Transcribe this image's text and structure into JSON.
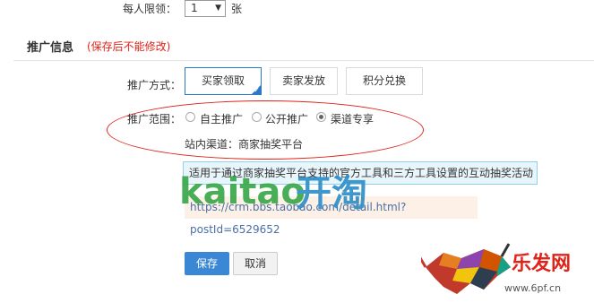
{
  "limit": {
    "label": "每人限领：",
    "value": "1",
    "unit": "张"
  },
  "section": {
    "title": "推广信息",
    "note": "(保存后不能修改)"
  },
  "method": {
    "label": "推广方式：",
    "options": [
      {
        "label": "买家领取",
        "selected": true
      },
      {
        "label": "卖家发放",
        "selected": false
      },
      {
        "label": "积分兑换",
        "selected": false
      }
    ]
  },
  "scope": {
    "label": "推广范围：",
    "options": [
      {
        "label": "自主推广",
        "checked": false
      },
      {
        "label": "公开推广",
        "checked": false
      },
      {
        "label": "渠道专享",
        "checked": true
      }
    ],
    "station_label": "站内渠道：",
    "station_value": "商家抽奖平台"
  },
  "info": {
    "description": "适用于通过商家抽奖平台支持的官方工具和三方工具设置的互动抽奖活动",
    "url": "https://crm.bbs.taobao.com/detail.html?postId=6529652"
  },
  "actions": {
    "save": "保存",
    "cancel": "取消"
  },
  "watermark": {
    "kaitao_text": "kaitao",
    "kaitao_cn": "开淘",
    "brand": "乐发网",
    "brand_url": "www.6pf.cn"
  },
  "colors": {
    "primary": "#3a87d6",
    "active_border": "#2b78c9",
    "warning_red": "#e2231a",
    "kaitao_green": "#3aa84a"
  }
}
